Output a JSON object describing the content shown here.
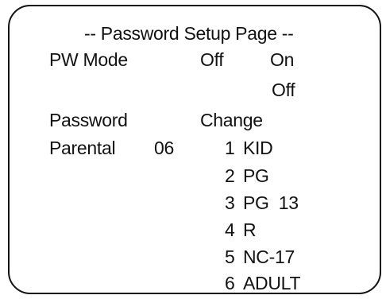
{
  "title": "-- Password Setup Page --",
  "pw_mode": {
    "label": "PW Mode",
    "current_value": "Off",
    "options": [
      "On",
      "Off"
    ]
  },
  "password": {
    "label": "Password",
    "action": "Change"
  },
  "parental": {
    "label": "Parental",
    "value": "06",
    "levels": [
      {
        "number": "1",
        "rating": "KID"
      },
      {
        "number": "2",
        "rating": "PG"
      },
      {
        "number": "3",
        "rating": "PG  13"
      },
      {
        "number": "4",
        "rating": "R"
      },
      {
        "number": "5",
        "rating": "NC-17"
      },
      {
        "number": "6",
        "rating": "ADULT"
      }
    ]
  }
}
